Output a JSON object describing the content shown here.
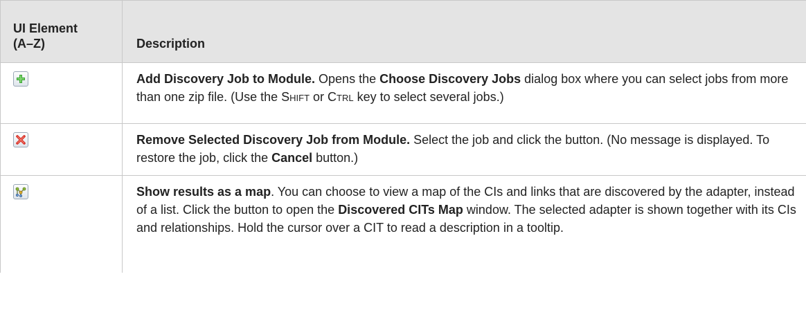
{
  "header": {
    "col1_line1": "UI Element",
    "col1_line2": "(A–Z)",
    "col2": "Description"
  },
  "rows": [
    {
      "icon": "add-icon",
      "title": "Add Discovery Job to Module.",
      "t1": " Opens the ",
      "b1": "Choose Discovery Jobs",
      "t2": " dialog box where you can select jobs from more than one zip file. (Use the ",
      "k1": "Shift",
      "t3": " or ",
      "k2": "Ctrl",
      "t4": " key to select several jobs.)"
    },
    {
      "icon": "remove-icon",
      "title": "Remove Selected Discovery Job from Module.",
      "t1": " Select the job and click the button. (No message is displayed. To restore the job, click the ",
      "b1": "Cancel",
      "t2": " button.)"
    },
    {
      "icon": "map-icon",
      "title": "Show results as a map",
      "t1": ". You can choose to view a map of the CIs and links that are discovered by the adapter, instead of a list. Click the button to open the ",
      "b1": "Discovered CITs Map",
      "t2": " window. The selected adapter is shown together with its CIs and relationships. Hold the cursor over a CIT to read a description in a tooltip."
    }
  ],
  "colors": {
    "header_bg": "#e4e4e4",
    "border": "#c8c8c8",
    "add_green": "#3aa535",
    "remove_red": "#d8322a"
  }
}
